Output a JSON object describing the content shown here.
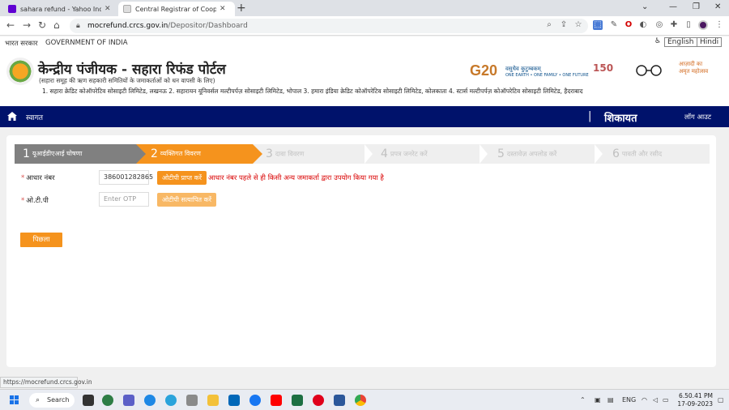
{
  "browser": {
    "tabs": [
      {
        "title": "sahara refund - Yahoo India Sea",
        "favicon": "yahoo-icon"
      },
      {
        "title": "Central Registrar of Cooperative",
        "favicon": "crcs-icon"
      }
    ],
    "new_tab": "+",
    "url_host": "mocrefund.crcs.gov.in",
    "url_path": "/Depositor/Dashboard",
    "status_url": "https://mocrefund.crcs.gov.in"
  },
  "gov_strip": {
    "hindi": "भारत सरकार",
    "english": "GOVERNMENT OF INDIA",
    "lang_en": "English",
    "lang_hi": "Hindi"
  },
  "header": {
    "title": "केन्द्रीय पंजीयक - सहारा रिफंड पोर्टल",
    "subtitle": "(सहारा समूह की ऋण सहकारी समितियों के जमाकर्ताओं को धन वापसी के लिए)",
    "societies": "1. सहारा क्रेडिट कोऑपरेटिव सोसाइटी लिमिटेड, लखनऊ 2. सहारायन यूनिवर्सल मल्टीपर्पज़ सोसाइटी लिमिटेड, भोपाल 3. हमारा इंडिया क्रेडिट कोऑपरेटिव सोसाइटी लिमिटेड, कोलकाता 4. स्टार्स मल्टीपर्पज़ कोऑपरेटिव सोसाइटी लिमिटेड, हैदराबाद",
    "logo_g20": "G20",
    "logo_vasudhaiva": "वसुधैव कुटुम्बकम्",
    "logo_tagline": "ONE EARTH • ONE FAMILY • ONE FUTURE",
    "logo_150": "150",
    "logo_amrit_1": "आज़ादी का",
    "logo_amrit_2": "अमृत महोत्सव"
  },
  "navbar": {
    "welcome": "स्वागत",
    "separator": "|",
    "complaint": "शिकायत",
    "logout": "लॉग आउट"
  },
  "steps": [
    {
      "num": "1",
      "label": "यूआईडीएआई घोषणा",
      "state": "done"
    },
    {
      "num": "2",
      "label": "व्यक्तिगत विवरण",
      "state": "active"
    },
    {
      "num": "3",
      "label": "दावा विवरण",
      "state": "pending"
    },
    {
      "num": "4",
      "label": "प्रपत्र जनरेट करें",
      "state": "pending"
    },
    {
      "num": "5",
      "label": "दस्तावेज़ अपलोड करें",
      "state": "pending"
    },
    {
      "num": "6",
      "label": "पावती और रसीद",
      "state": "pending"
    }
  ],
  "form": {
    "aadhaar_label": "आधार नंबर",
    "aadhaar_value": "386001282865",
    "get_otp": "ओटीपी प्राप्त करें",
    "error": "आधार नंबर पहले से ही किसी अन्य जमाकर्ता द्वारा उपयोग किया गया है",
    "otp_label": "ओ.टी.पी",
    "otp_placeholder": "Enter OTP",
    "verify_otp": "ओटीपी सत्यापित करें",
    "back": "पिछला",
    "required_mark": "*"
  },
  "taskbar": {
    "search": "Search",
    "lang": "ENG",
    "time": "6.50.41 PM",
    "date": "17-09-2023"
  },
  "colors": {
    "navbar": "#00126b",
    "accent": "#f5931d",
    "step_done": "#808080",
    "error": "#d90000"
  }
}
